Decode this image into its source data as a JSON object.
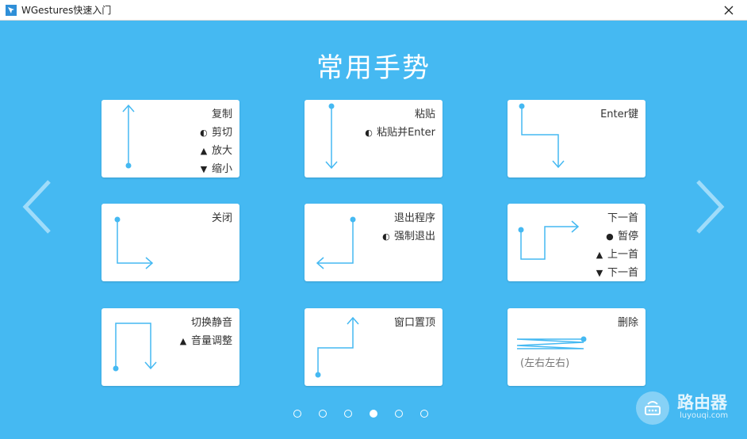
{
  "window": {
    "title": "WGestures快速入门"
  },
  "page": {
    "heading": "常用手势"
  },
  "colors": {
    "background": "#45b9f2",
    "stroke": "#45b9f2",
    "card": "#ffffff"
  },
  "cards": [
    {
      "name": "copy",
      "lines": [
        {
          "glyph": "",
          "text": "复制"
        },
        {
          "glyph": "◐",
          "text": "剪切"
        },
        {
          "glyph": "▲",
          "text": "放大"
        },
        {
          "glyph": "▼",
          "text": "缩小"
        }
      ]
    },
    {
      "name": "paste",
      "lines": [
        {
          "glyph": "",
          "text": "粘贴"
        },
        {
          "glyph": "◐",
          "text": "粘贴并Enter"
        }
      ]
    },
    {
      "name": "enter",
      "lines": [
        {
          "glyph": "",
          "text": "Enter键"
        }
      ]
    },
    {
      "name": "close",
      "lines": [
        {
          "glyph": "",
          "text": "关闭"
        }
      ]
    },
    {
      "name": "quit",
      "lines": [
        {
          "glyph": "",
          "text": "退出程序"
        },
        {
          "glyph": "◐",
          "text": "强制退出"
        }
      ]
    },
    {
      "name": "next-track",
      "lines": [
        {
          "glyph": "",
          "text": "下一首"
        },
        {
          "glyph": "●",
          "text": "暂停"
        },
        {
          "glyph": "▲",
          "text": "上一首"
        },
        {
          "glyph": "▼",
          "text": "下一首"
        }
      ]
    },
    {
      "name": "mute",
      "lines": [
        {
          "glyph": "",
          "text": "切换静音"
        },
        {
          "glyph": "▲",
          "text": "音量调整"
        }
      ]
    },
    {
      "name": "topmost",
      "lines": [
        {
          "glyph": "",
          "text": "窗口置顶"
        }
      ]
    },
    {
      "name": "delete",
      "lines": [
        {
          "glyph": "",
          "text": "删除"
        }
      ],
      "caption": "(左右左右)"
    }
  ],
  "pager": {
    "count": 6,
    "active": 4
  },
  "watermark": {
    "title": "路由器",
    "url": "luyouqi.com"
  }
}
